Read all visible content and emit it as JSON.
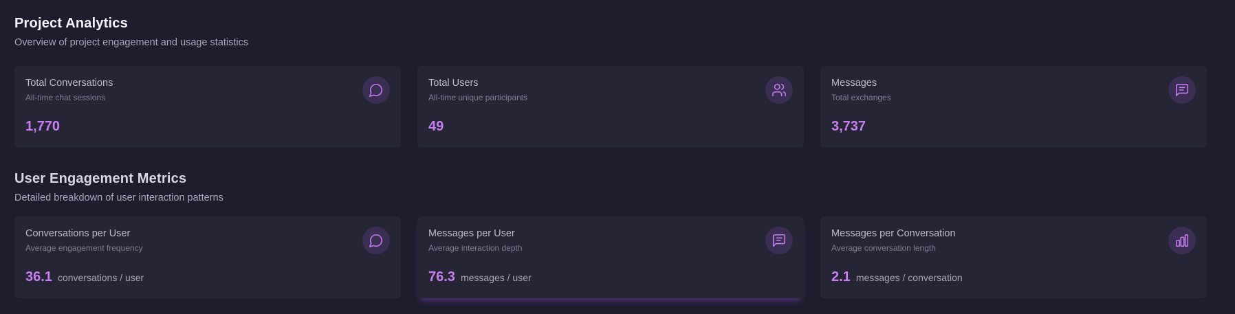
{
  "analytics": {
    "title": "Project Analytics",
    "subtitle": "Overview of project engagement and usage statistics",
    "cards": [
      {
        "title": "Total Conversations",
        "subtitle": "All-time chat sessions",
        "value": "1,770",
        "icon": "chat-bubble-icon"
      },
      {
        "title": "Total Users",
        "subtitle": "All-time unique participants",
        "value": "49",
        "icon": "users-icon"
      },
      {
        "title": "Messages",
        "subtitle": "Total exchanges",
        "value": "3,737",
        "icon": "message-square-icon"
      }
    ]
  },
  "engagement": {
    "title": "User Engagement Metrics",
    "subtitle": "Detailed breakdown of user interaction patterns",
    "cards": [
      {
        "title": "Conversations per User",
        "subtitle": "Average engagement frequency",
        "value": "36.1",
        "unit": "conversations / user",
        "icon": "chat-bubble-icon"
      },
      {
        "title": "Messages per User",
        "subtitle": "Average interaction depth",
        "value": "76.3",
        "unit": "messages / user",
        "icon": "message-square-icon"
      },
      {
        "title": "Messages per Conversation",
        "subtitle": "Average conversation length",
        "value": "2.1",
        "unit": "messages / conversation",
        "icon": "bar-chart-icon"
      }
    ]
  },
  "colors": {
    "accent": "#c57ff0",
    "background": "#1e1c2d",
    "card": "#262536"
  }
}
